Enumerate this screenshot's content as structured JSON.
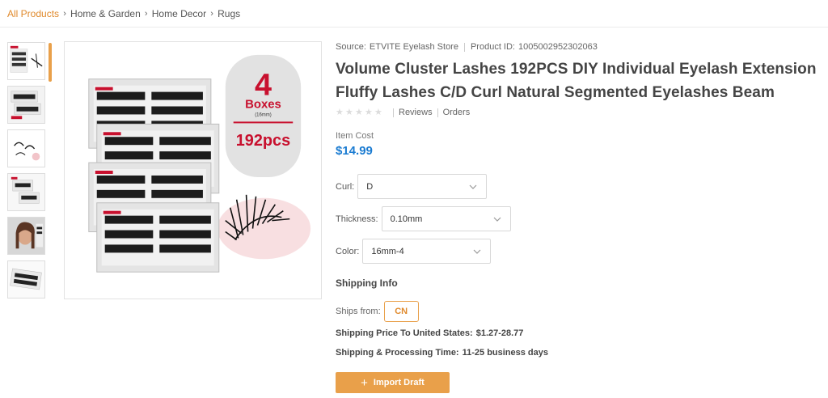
{
  "breadcrumb": {
    "items": [
      "All Products",
      "Home & Garden",
      "Home Decor",
      "Rugs"
    ]
  },
  "gallery": {
    "main_image": {
      "badge_number": "4",
      "badge_word": "Boxes",
      "badge_size": "(16mm)",
      "badge_count": "192pcs"
    },
    "thumbnail_count": 6
  },
  "product": {
    "source_label": "Source:",
    "source_value": "ETVITE Eyelash Store",
    "product_id_label": "Product ID:",
    "product_id_value": "1005002952302063",
    "title": "Volume Cluster Lashes 192PCS DIY Individual Eyelash Extension Fluffy Lashes C/D Curl Natural Segmented Eyelashes Beam",
    "reviews_label": "Reviews",
    "orders_label": "Orders",
    "rating_stars": 0,
    "item_cost_label": "Item Cost",
    "item_cost_value": "$14.99"
  },
  "options": {
    "curl": {
      "label": "Curl:",
      "value": "D"
    },
    "thickness": {
      "label": "Thickness:",
      "value": "0.10mm"
    },
    "color": {
      "label": "Color:",
      "value": "16mm-4"
    }
  },
  "shipping": {
    "heading": "Shipping Info",
    "ships_from_label": "Ships from:",
    "ships_from_value": "CN",
    "price_label": "Shipping Price To United States:",
    "price_value": "$1.27-28.77",
    "processing_label": "Shipping & Processing Time:",
    "processing_value": "11-25 business days"
  },
  "actions": {
    "import_label": "Import Draft"
  },
  "colors": {
    "accent": "#e9a04a",
    "price": "#1a7bd1",
    "badge_red": "#c8102e"
  }
}
